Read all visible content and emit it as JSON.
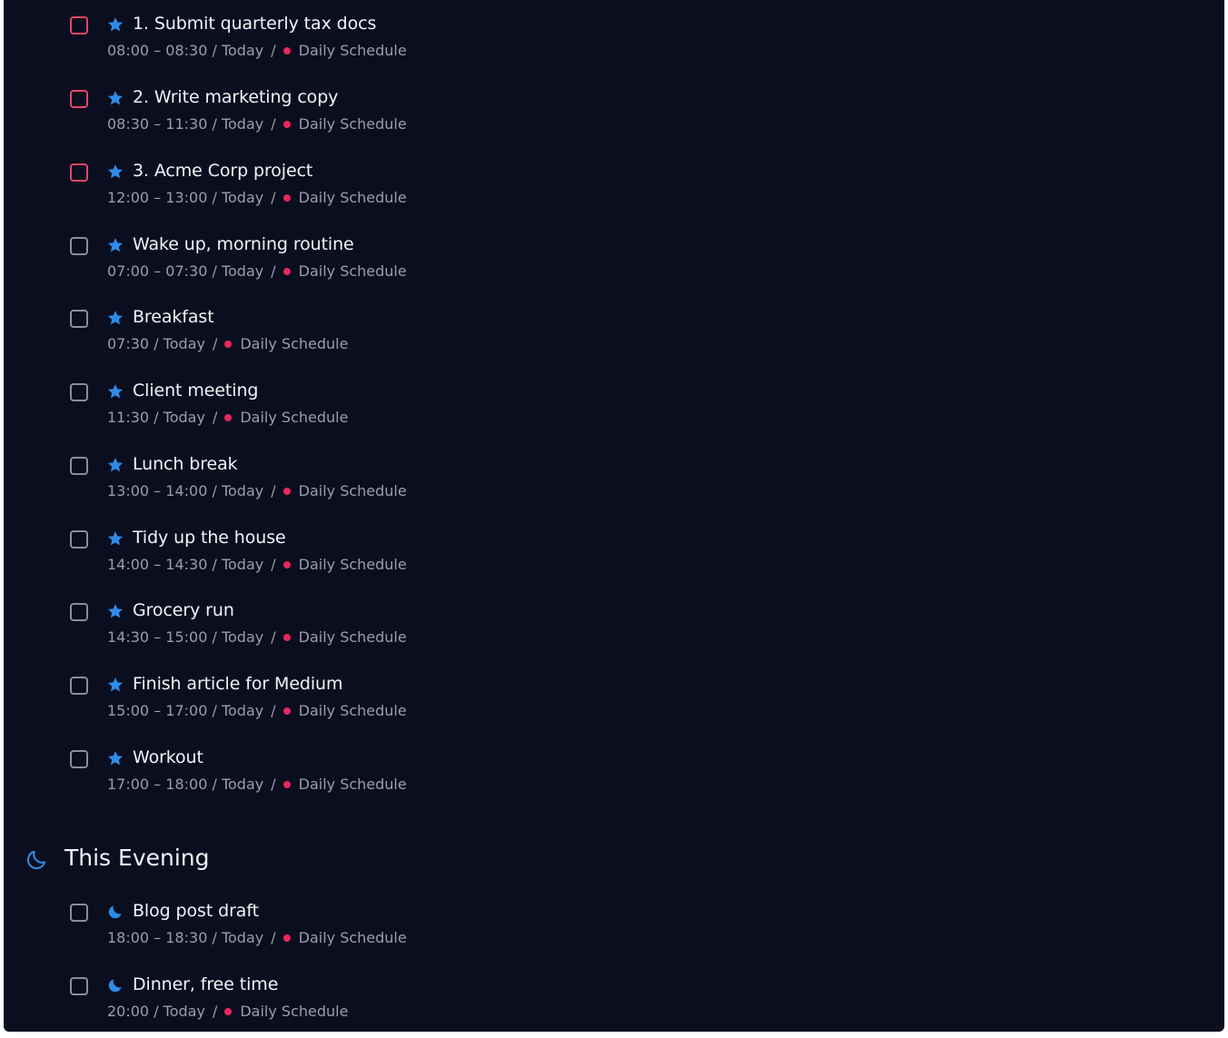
{
  "colors": {
    "background": "#0b0e1f",
    "priority_border": "#e2476a",
    "checkbox_border": "#8b8e98",
    "star": "#2d8ce8",
    "project_dot": "#e8275e"
  },
  "tasks": [
    {
      "title": "1. Submit quarterly tax docs",
      "time": "08:00 – 08:30 / Today",
      "separator": "/",
      "project": "Daily Schedule",
      "icon": "star-icon",
      "priority": true
    },
    {
      "title": "2. Write marketing copy",
      "time": "08:30 – 11:30 / Today",
      "separator": "/",
      "project": "Daily Schedule",
      "icon": "star-icon",
      "priority": true
    },
    {
      "title": "3. Acme Corp project",
      "time": "12:00 – 13:00 / Today",
      "separator": "/",
      "project": "Daily Schedule",
      "icon": "star-icon",
      "priority": true
    },
    {
      "title": "Wake up, morning routine",
      "time": "07:00 – 07:30 / Today",
      "separator": "/",
      "project": "Daily Schedule",
      "icon": "star-icon",
      "priority": false
    },
    {
      "title": "Breakfast",
      "time": "07:30 / Today",
      "separator": "/",
      "project": "Daily Schedule",
      "icon": "star-icon",
      "priority": false
    },
    {
      "title": "Client meeting",
      "time": "11:30 / Today",
      "separator": "/",
      "project": "Daily Schedule",
      "icon": "star-icon",
      "priority": false
    },
    {
      "title": "Lunch break",
      "time": "13:00 – 14:00 / Today",
      "separator": "/",
      "project": "Daily Schedule",
      "icon": "star-icon",
      "priority": false
    },
    {
      "title": "Tidy up the house",
      "time": "14:00 – 14:30 / Today",
      "separator": "/",
      "project": "Daily Schedule",
      "icon": "star-icon",
      "priority": false
    },
    {
      "title": "Grocery run",
      "time": "14:30 – 15:00 / Today",
      "separator": "/",
      "project": "Daily Schedule",
      "icon": "star-icon",
      "priority": false
    },
    {
      "title": "Finish article for Medium",
      "time": "15:00 – 17:00 / Today",
      "separator": "/",
      "project": "Daily Schedule",
      "icon": "star-icon",
      "priority": false
    },
    {
      "title": "Workout",
      "time": "17:00 – 18:00 / Today",
      "separator": "/",
      "project": "Daily Schedule",
      "icon": "star-icon",
      "priority": false
    }
  ],
  "evening": {
    "title": "This Evening",
    "icon": "moon-icon",
    "tasks": [
      {
        "title": "Blog post draft",
        "time": "18:00 – 18:30 / Today",
        "separator": "/",
        "project": "Daily Schedule",
        "icon": "moon-icon",
        "priority": false
      },
      {
        "title": "Dinner, free time",
        "time": "20:00 / Today",
        "separator": "/",
        "project": "Daily Schedule",
        "icon": "moon-icon",
        "priority": false
      }
    ]
  }
}
